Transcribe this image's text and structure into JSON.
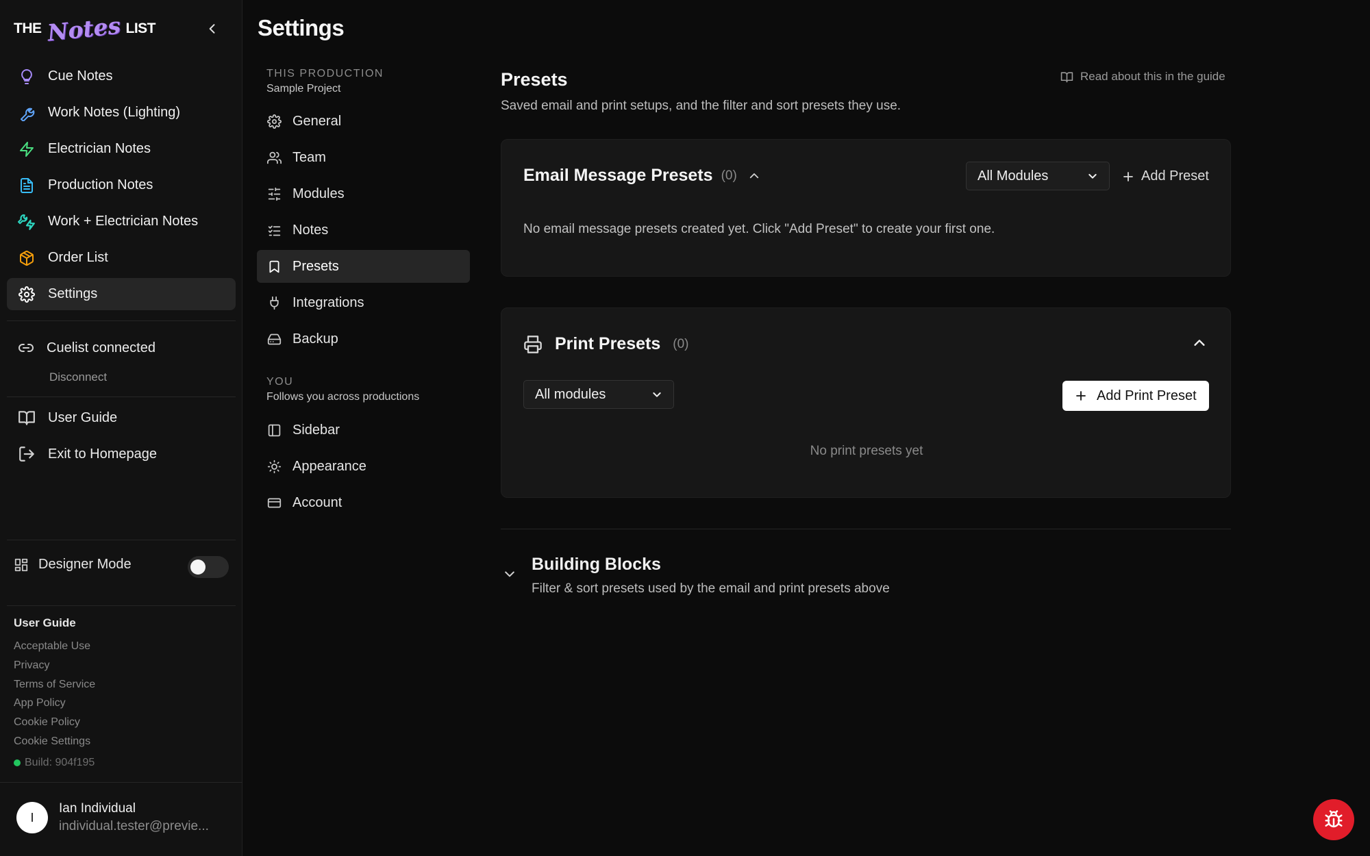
{
  "logo": {
    "the": "THE",
    "notes": "Notes",
    "list": "LIST"
  },
  "sidebar": {
    "items": [
      {
        "label": "Cue Notes",
        "icon": "lightbulb-icon",
        "color": "#a78bfa"
      },
      {
        "label": "Work Notes (Lighting)",
        "icon": "wrench-icon",
        "color": "#60a5fa"
      },
      {
        "label": "Electrician Notes",
        "icon": "zap-icon",
        "color": "#4ade80"
      },
      {
        "label": "Production Notes",
        "icon": "file-text-icon",
        "color": "#38bdf8"
      },
      {
        "label": "Work + Electrician Notes",
        "icon": "wrench-zap-icon",
        "color": "#2dd4bf"
      },
      {
        "label": "Order List",
        "icon": "package-icon",
        "color": "#f59e0b"
      },
      {
        "label": "Settings",
        "icon": "gear-icon",
        "color": "#ffffff",
        "active": true
      }
    ],
    "cuelist": "Cuelist connected",
    "disconnect": "Disconnect",
    "user_guide": "User Guide",
    "exit": "Exit to Homepage",
    "designer_mode": "Designer Mode",
    "footer_title": "User Guide",
    "footer_links": [
      "Acceptable Use",
      "Privacy",
      "Terms of Service",
      "App Policy",
      "Cookie Policy",
      "Cookie Settings"
    ],
    "build": "Build: 904f195",
    "user": {
      "initial": "I",
      "name": "Ian Individual",
      "email": "individual.tester@previe..."
    }
  },
  "settings": {
    "title": "Settings",
    "production_label": "THIS PRODUCTION",
    "production_name": "Sample Project",
    "production_items": [
      {
        "label": "General",
        "icon": "gear-icon"
      },
      {
        "label": "Team",
        "icon": "users-icon"
      },
      {
        "label": "Modules",
        "icon": "sliders-icon"
      },
      {
        "label": "Notes",
        "icon": "list-checks-icon"
      },
      {
        "label": "Presets",
        "icon": "bookmark-icon",
        "active": true
      },
      {
        "label": "Integrations",
        "icon": "plug-icon"
      },
      {
        "label": "Backup",
        "icon": "hard-drive-icon"
      }
    ],
    "you_label": "YOU",
    "you_sub": "Follows you across productions",
    "you_items": [
      {
        "label": "Sidebar",
        "icon": "panel-left-icon"
      },
      {
        "label": "Appearance",
        "icon": "sun-icon"
      },
      {
        "label": "Account",
        "icon": "credit-card-icon"
      }
    ]
  },
  "main": {
    "title": "Presets",
    "subtitle": "Saved email and print setups, and the filter and sort presets they use.",
    "guide_link": "Read about this in the guide",
    "email": {
      "title": "Email Message Presets",
      "count": "(0)",
      "filter": "All Modules",
      "add": "Add Preset",
      "empty": "No email message presets created yet. Click \"Add Preset\" to create your first one."
    },
    "print": {
      "title": "Print Presets",
      "count": "(0)",
      "filter": "All modules",
      "add": "Add Print Preset",
      "empty": "No print presets yet"
    },
    "building_blocks": {
      "title": "Building Blocks",
      "subtitle": "Filter & sort presets used by the email and print presets above"
    }
  }
}
